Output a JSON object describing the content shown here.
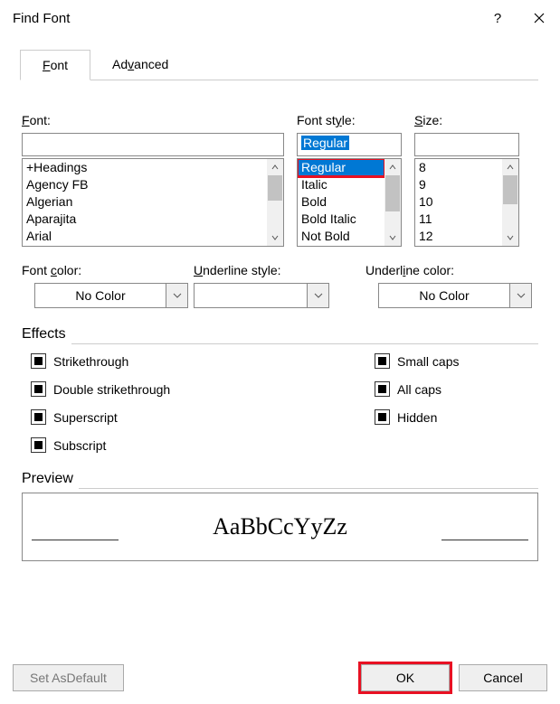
{
  "title": "Find Font",
  "tabs": [
    {
      "label_pre": "",
      "ul": "F",
      "label_post": "ont",
      "active": true
    },
    {
      "label_pre": "Ad",
      "ul": "v",
      "label_post": "anced",
      "active": false
    }
  ],
  "font": {
    "label_ul": "F",
    "label_post": "ont:",
    "value": "",
    "list": [
      "+Headings",
      "Agency FB",
      "Algerian",
      "Aparajita",
      "Arial"
    ]
  },
  "fontstyle": {
    "label_pre": "Font st",
    "label_ul": "y",
    "label_post": "le:",
    "value": "Regular",
    "list": [
      "Regular",
      "Italic",
      "Bold",
      "Bold Italic",
      "Not Bold"
    ],
    "selected_index": 0
  },
  "size": {
    "label_ul": "S",
    "label_post": "ize:",
    "value": "",
    "list": [
      "8",
      "9",
      "10",
      "11",
      "12"
    ]
  },
  "fontcolor": {
    "label_pre": "Font ",
    "label_ul": "c",
    "label_post": "olor:",
    "value": "No Color"
  },
  "underlinestyle": {
    "label_ul": "U",
    "label_post": "nderline style:",
    "value": ""
  },
  "underlinecolor": {
    "label_pre": "Underl",
    "label_ul": "i",
    "label_post": "ne color:",
    "value": "No Color"
  },
  "effects": {
    "heading": "Effects",
    "left": [
      {
        "pre": "Stri",
        "ul": "k",
        "post": "ethrough"
      },
      {
        "pre": "Doub",
        "ul": "l",
        "post": "e strikethrough"
      },
      {
        "pre": "Su",
        "ul": "p",
        "post": "erscript"
      },
      {
        "pre": "Su",
        "ul": "b",
        "post": "script"
      }
    ],
    "right": [
      {
        "pre": "S",
        "ul": "m",
        "post": "all caps"
      },
      {
        "pre": "",
        "ul": "A",
        "post": "ll caps"
      },
      {
        "pre": "",
        "ul": "H",
        "post": "idden"
      }
    ]
  },
  "preview": {
    "heading": "Preview",
    "sample": "AaBbCcYyZz"
  },
  "buttons": {
    "set_default_pre": "Set As ",
    "set_default_ul": "D",
    "set_default_post": "efault",
    "ok": "OK",
    "cancel": "Cancel"
  }
}
